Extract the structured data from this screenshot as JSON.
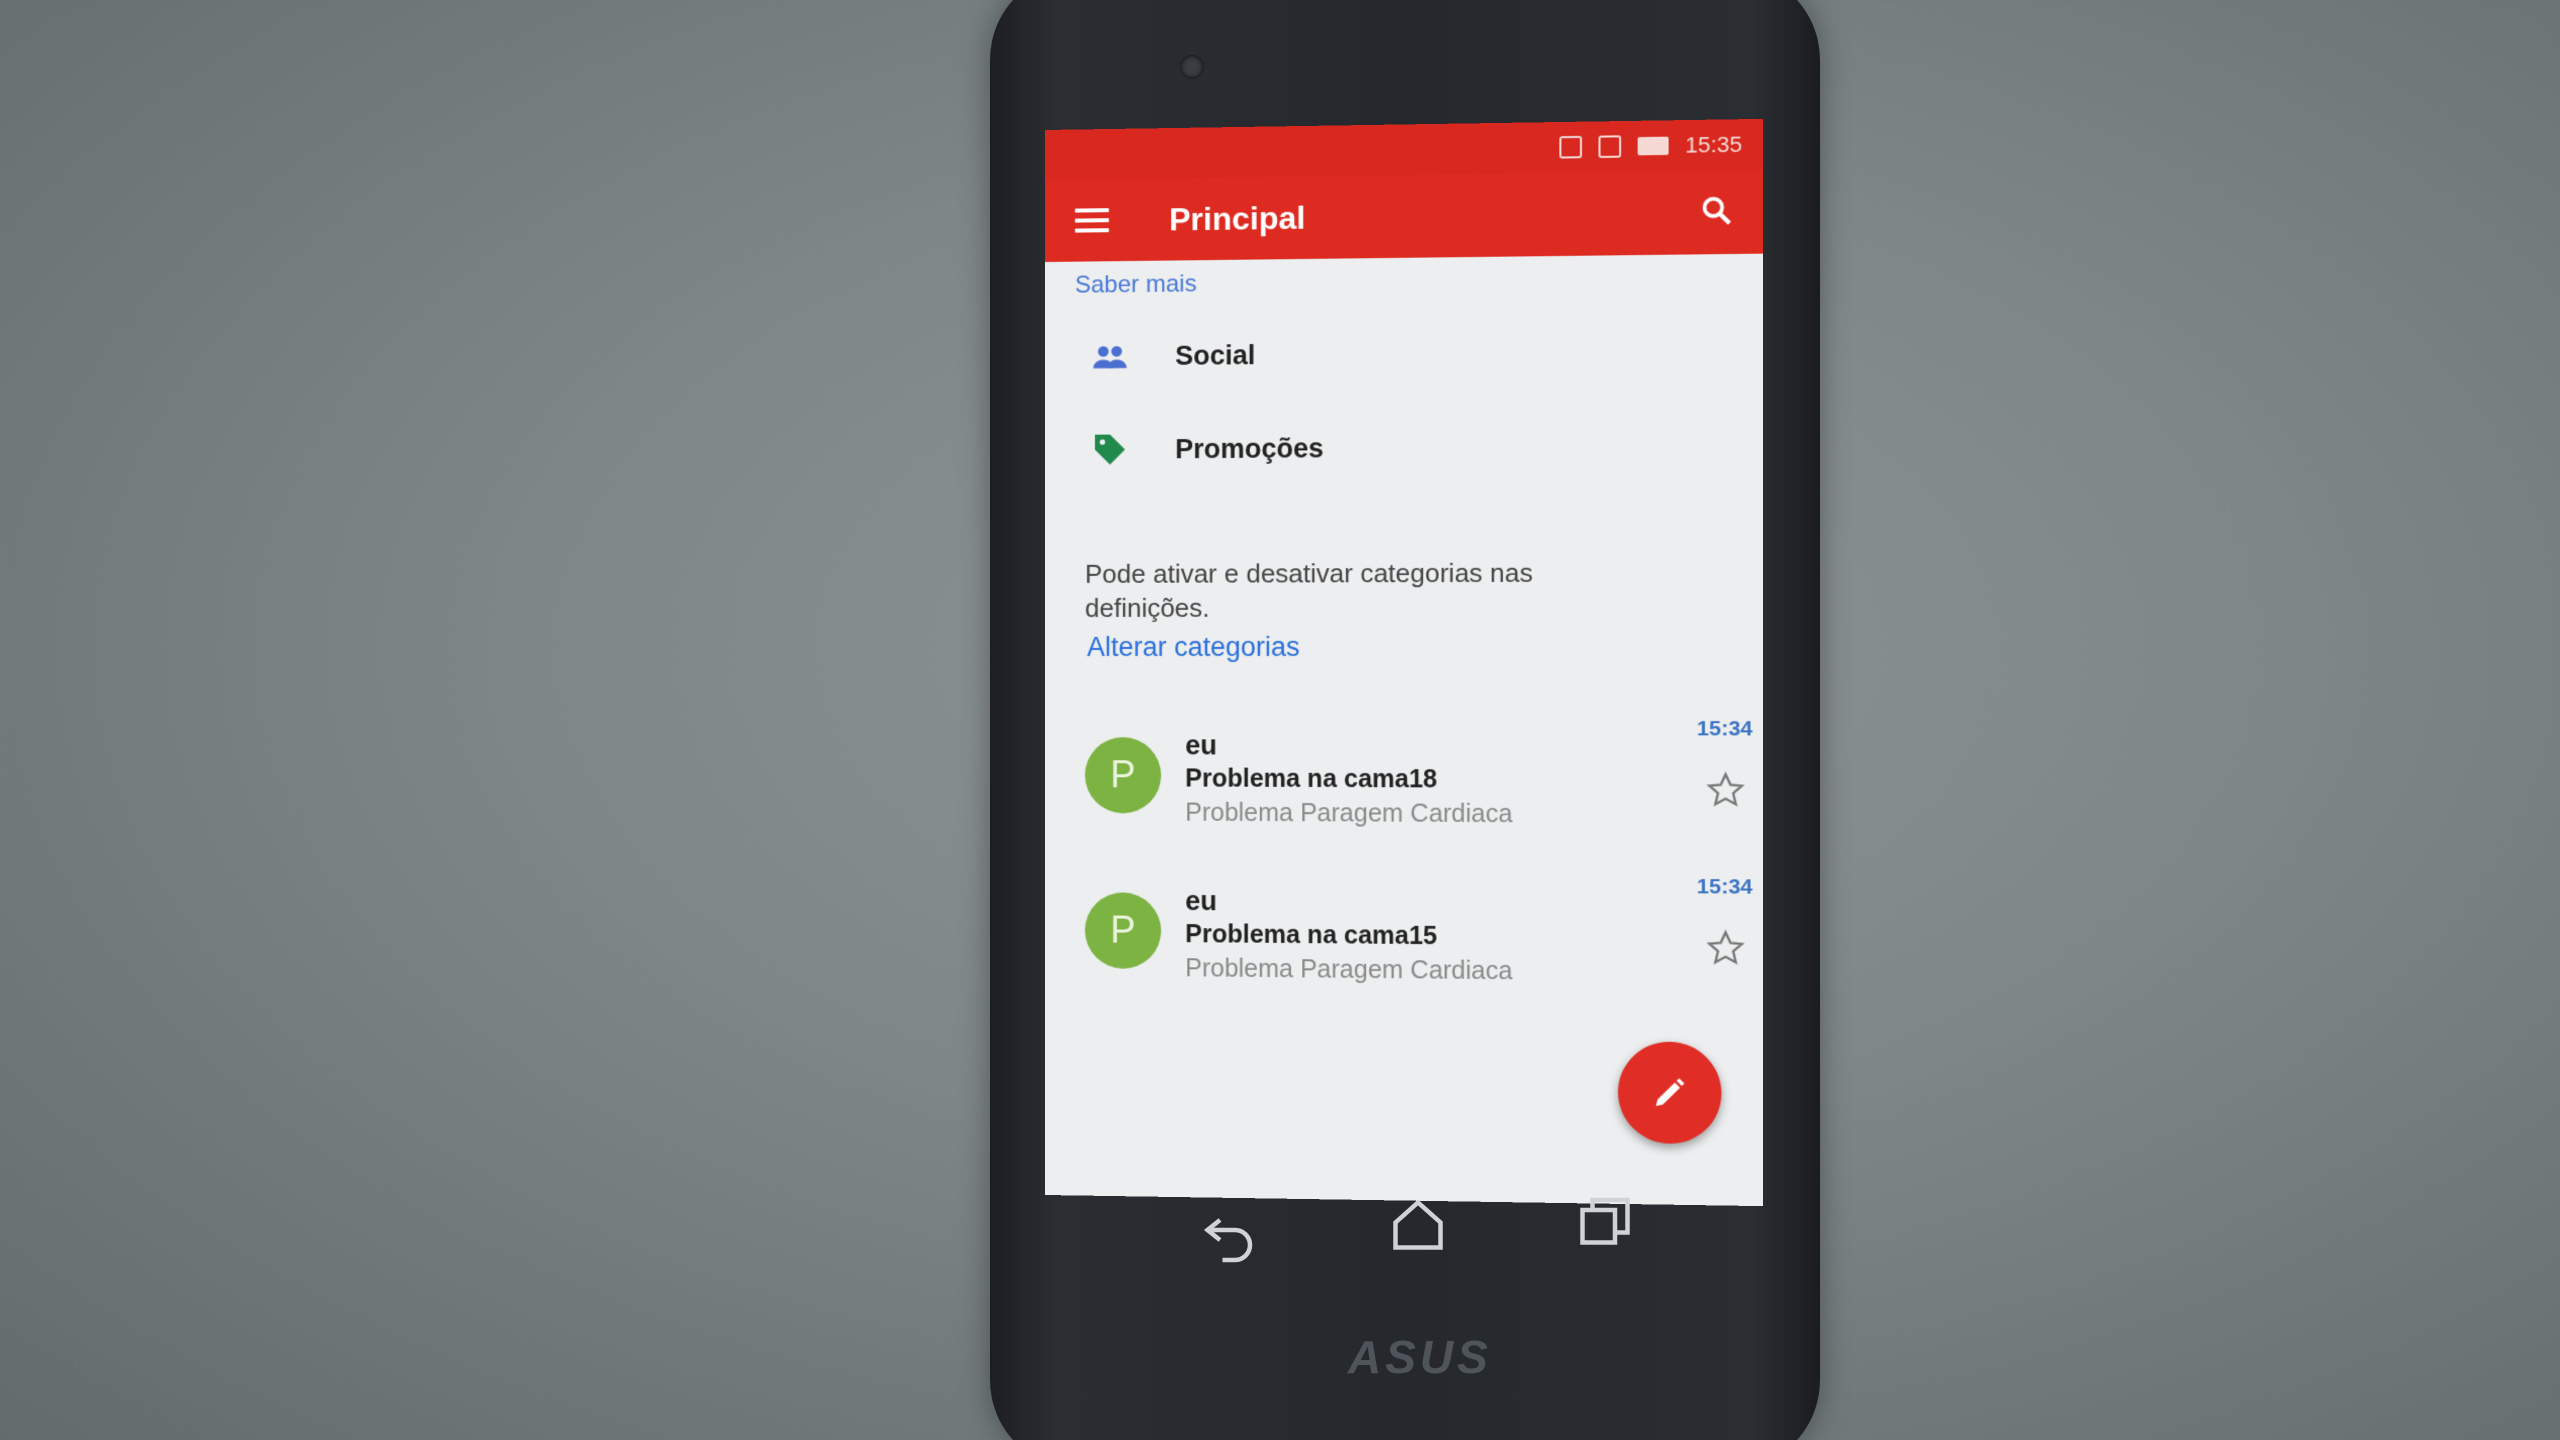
{
  "status_bar": {
    "time": "15:35"
  },
  "app_bar": {
    "title": "Principal"
  },
  "promo_link": {
    "label": "Saber mais"
  },
  "categories": [
    {
      "label": "Social",
      "icon": "people-icon",
      "color": "#4a6fd1"
    },
    {
      "label": "Promoções",
      "icon": "tag-icon",
      "color": "#1f8a4c"
    }
  ],
  "info": {
    "text": "Pode ativar e desativar categorias nas definições.",
    "link": "Alterar categorias"
  },
  "emails": [
    {
      "avatar_letter": "P",
      "sender": "eu",
      "subject": "Problema na cama18",
      "snippet": "Problema Paragem Cardiaca",
      "time": "15:34",
      "starred": false
    },
    {
      "avatar_letter": "P",
      "sender": "eu",
      "subject": "Problema na cama15",
      "snippet": "Problema Paragem Cardiaca",
      "time": "15:34",
      "starred": false
    }
  ],
  "device": {
    "brand": "ASUS"
  },
  "colors": {
    "accent": "#dd2b22",
    "link": "#2a6fdd",
    "avatar": "#7cb342"
  }
}
